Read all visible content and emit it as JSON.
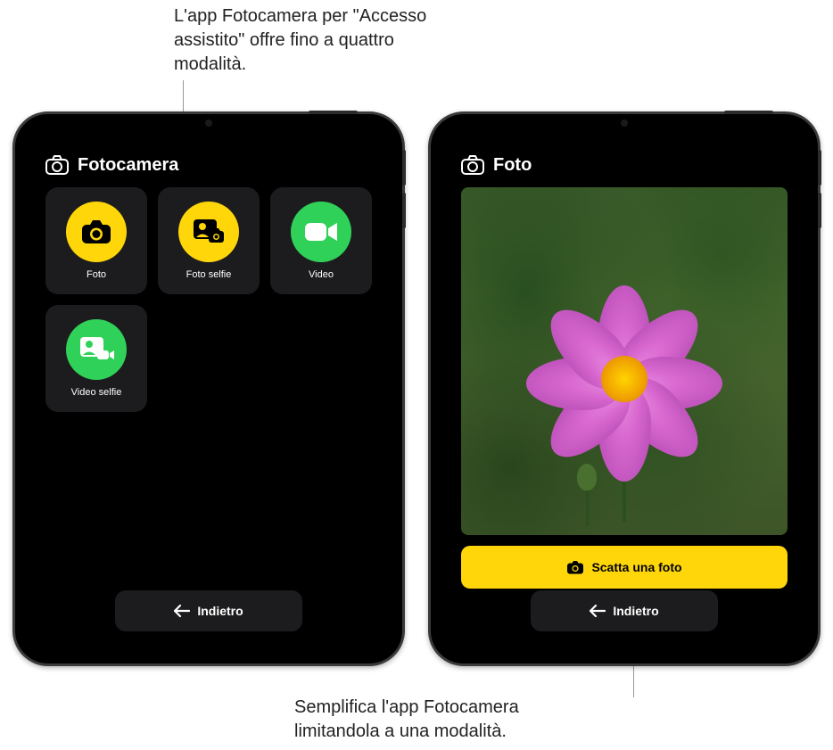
{
  "callouts": {
    "top": "L'app Fotocamera per \"Accesso assistito\" offre fino a quattro modalità.",
    "bottom": "Semplifica l'app Fotocamera limitandola a una modalità."
  },
  "left_device": {
    "header_title": "Fotocamera",
    "modes": [
      {
        "label": "Foto",
        "icon": "camera",
        "color": "yellow"
      },
      {
        "label": "Foto selfie",
        "icon": "selfie-camera",
        "color": "yellow"
      },
      {
        "label": "Video",
        "icon": "video",
        "color": "green"
      },
      {
        "label": "Video selfie",
        "icon": "selfie-video",
        "color": "green"
      }
    ],
    "back_label": "Indietro"
  },
  "right_device": {
    "header_title": "Foto",
    "capture_label": "Scatta una foto",
    "back_label": "Indietro"
  },
  "colors": {
    "accent_yellow": "#ffd60a",
    "accent_green": "#30d158",
    "tile_bg": "#1c1c1e"
  }
}
